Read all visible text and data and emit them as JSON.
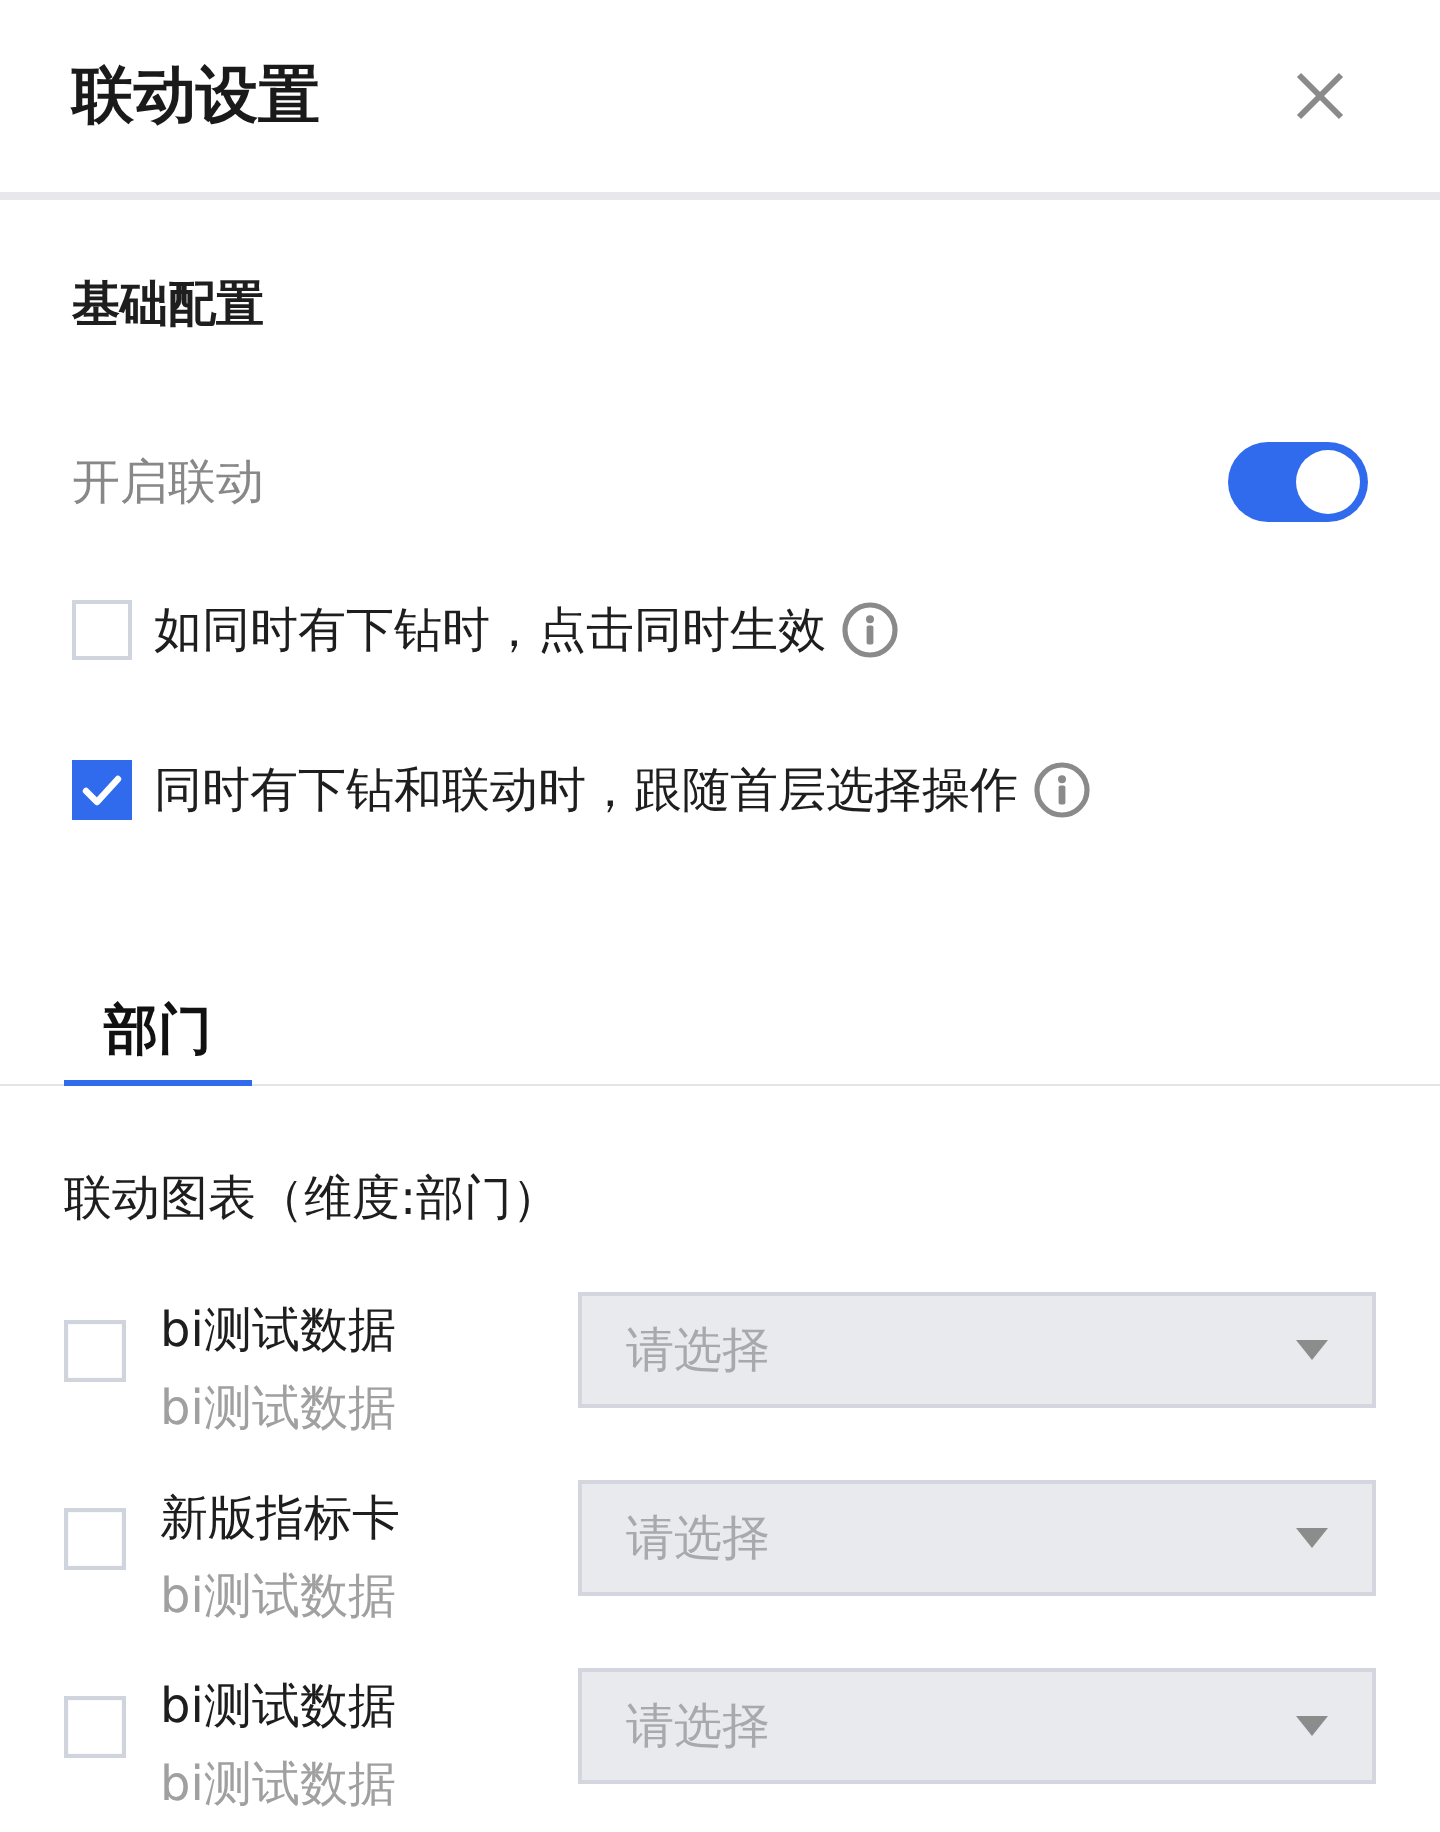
{
  "dialog": {
    "title": "联动设置"
  },
  "basic": {
    "heading": "基础配置",
    "toggle": {
      "label": "开启联动",
      "on": true
    },
    "options": [
      {
        "label": "如同时有下钻时，点击同时生效",
        "checked": false
      },
      {
        "label": "同时有下钻和联动时，跟随首层选择操作",
        "checked": true
      }
    ]
  },
  "tabs": [
    {
      "label": "部门",
      "selected": true
    }
  ],
  "linked_charts": {
    "heading": "联动图表（维度:部门）",
    "rows": [
      {
        "title": "bi测试数据",
        "subtitle": "bi测试数据",
        "checked": false,
        "select": {
          "placeholder": "请选择",
          "disabled": true
        }
      },
      {
        "title": "新版指标卡",
        "subtitle": "bi测试数据",
        "checked": false,
        "select": {
          "placeholder": "请选择",
          "disabled": true
        }
      },
      {
        "title": "bi测试数据",
        "subtitle": "bi测试数据",
        "checked": false,
        "select": {
          "placeholder": "请选择",
          "disabled": true
        }
      }
    ]
  }
}
